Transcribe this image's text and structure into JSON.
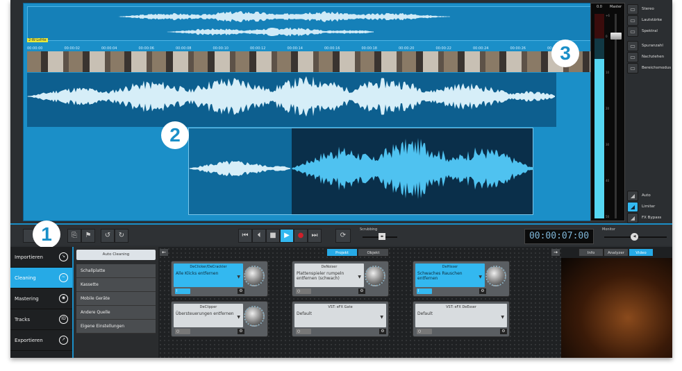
{
  "timeline": {
    "track_tag": "2-W-Lsfrte",
    "ruler": [
      "00:00:00",
      "00:00:02",
      "00:00:04",
      "00:00:06",
      "00:00:08",
      "00:00:10",
      "00:00:12",
      "00:00:14",
      "00:00:16",
      "00:00:18",
      "00:00:20",
      "00:00:22",
      "00:00:24",
      "00:00:26",
      "00:00:28"
    ],
    "callouts": [
      "1",
      "2",
      "3"
    ]
  },
  "meter": {
    "peak": "0.0",
    "label": "Master",
    "scale": [
      "+6",
      "0",
      "10",
      "20",
      "30",
      "40",
      "50"
    ],
    "level_fraction": 0.78
  },
  "view_buttons": [
    {
      "icon": "stereo-icon",
      "label": "Stereo"
    },
    {
      "icon": "volume-curve-icon",
      "label": "Lautstärke"
    },
    {
      "icon": "spectral-icon",
      "label": "Spektral"
    },
    {
      "icon": "track-count-icon",
      "label": "Spuranzahl"
    },
    {
      "icon": "follow-icon",
      "label": "Nachziehen"
    },
    {
      "icon": "range-mode-icon",
      "label": "Bereichsmodus"
    }
  ],
  "mode_buttons": [
    {
      "icon": "auto-icon",
      "label": "Auto"
    },
    {
      "icon": "limiter-icon",
      "label": "Limiter",
      "active": true
    },
    {
      "icon": "fx-bypass-icon",
      "label": "FX Bypass"
    }
  ],
  "toolbar": {
    "scrubbing_label": "Scrubbing",
    "monitor_label": "Monitor",
    "timecode": "00:00:07:00"
  },
  "nav": [
    {
      "label": "Importieren",
      "icon": "import-icon"
    },
    {
      "label": "Cleaning",
      "icon": "cleaning-icon",
      "active": true
    },
    {
      "label": "Mastering",
      "icon": "mastering-icon"
    },
    {
      "label": "Tracks",
      "icon": "tracks-icon"
    },
    {
      "label": "Exportieren",
      "icon": "export-icon"
    }
  ],
  "presets": {
    "auto": "Auto Cleaning",
    "items": [
      "Schallplatte",
      "Kassette",
      "Mobile Geräte",
      "Andere Quelle",
      "Eigene Einstellungen"
    ]
  },
  "fx": {
    "tabs": [
      "Projekt",
      "Objekt"
    ],
    "cards": [
      {
        "title": "DeClicker/DeCrackler",
        "value": "Alle Klicks entfernen",
        "on": true,
        "knob": true
      },
      {
        "title": "DeNoiser",
        "value": "Plattenspieler rumpeln entfernen (schwach)",
        "on": false,
        "knob": true
      },
      {
        "title": "DeHisser",
        "value": "Schwaches Rauschen entfernen",
        "on": true,
        "knob": true
      },
      {
        "title": "DeClipper",
        "value": "Übersteuerungen entfernen",
        "on": false,
        "knob": true
      },
      {
        "title": "VST: eFX Gate",
        "value": "Default",
        "on": false,
        "knob": false
      },
      {
        "title": "VST: eFX DeEsser",
        "value": "Default",
        "on": false,
        "knob": false
      }
    ]
  },
  "video_tabs": [
    "Info",
    "Analyzer",
    "Video"
  ]
}
